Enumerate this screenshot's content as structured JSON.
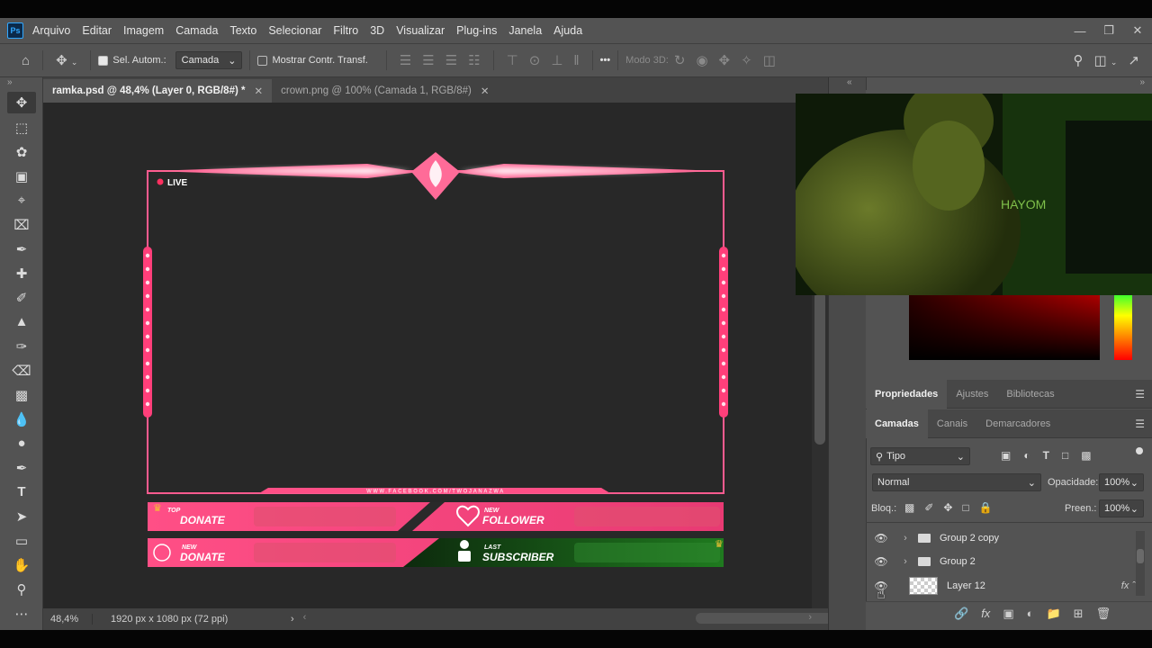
{
  "app": {
    "logo": "Ps"
  },
  "menu": [
    "Arquivo",
    "Editar",
    "Imagem",
    "Camada",
    "Texto",
    "Selecionar",
    "Filtro",
    "3D",
    "Visualizar",
    "Plug-ins",
    "Janela",
    "Ajuda"
  ],
  "options": {
    "auto_select_label": "Sel. Autom.:",
    "auto_select_value": "Camada",
    "transform_label": "Mostrar Contr. Transf.",
    "mode3d_label": "Modo 3D:",
    "more": "•••"
  },
  "tabs": [
    {
      "label": "ramka.psd @ 48,4% (Layer 0, RGB/8#) *",
      "active": true
    },
    {
      "label": "crown.png @ 100% (Camada 1, RGB/8#)",
      "active": false
    }
  ],
  "status": {
    "zoom": "48,4%",
    "doc_size": "1920 px x 1080 px (72 ppi)"
  },
  "artwork": {
    "live": "LIVE",
    "url": "WWW.FACEBOOK.COM/TWOJANAZWA",
    "top_donate_small": "TOP",
    "top_donate_big": "DONATE",
    "new_follower_small": "NEW",
    "new_follower_big": "FOLLOWER",
    "new_donate_small": "NEW",
    "new_donate_big": "DONATE",
    "last_sub_small": "LAST",
    "last_sub_big": "SUBSCRIBER"
  },
  "webcam": {
    "text": "HAYOM"
  },
  "props_panel": {
    "tabs": [
      "Propriedades",
      "Ajustes",
      "Bibliotecas"
    ]
  },
  "layers_panel": {
    "tabs": [
      "Camadas",
      "Canais",
      "Demarcadores"
    ],
    "filter_label": "Tipo",
    "blend_mode": "Normal",
    "opacity_label": "Opacidade:",
    "opacity_value": "100%",
    "lock_label": "Bloq.:",
    "fill_label": "Preen.:",
    "fill_value": "100%",
    "layers": [
      {
        "name": "Group 2 copy",
        "type": "group"
      },
      {
        "name": "Group 2",
        "type": "group"
      },
      {
        "name": "Layer 12",
        "type": "layer",
        "fx": "fx"
      }
    ]
  },
  "colors": {
    "accent_pink": "#ff4f86",
    "panel": "#535353",
    "canvas": "#282828"
  }
}
